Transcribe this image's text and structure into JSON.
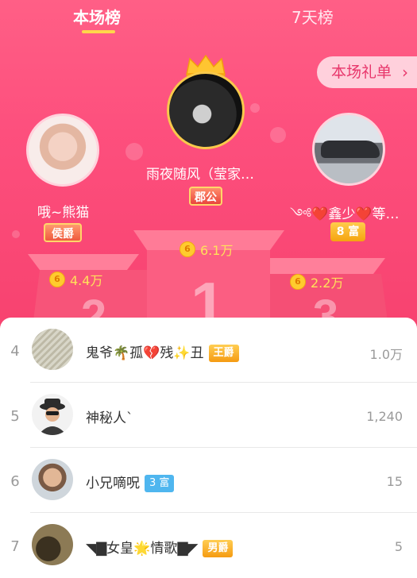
{
  "tabs": [
    {
      "label": "本场榜",
      "active": true
    },
    {
      "label": "7天榜",
      "active": false
    }
  ],
  "gift_button": {
    "label": "本场礼单",
    "icon": "chevron-right-icon"
  },
  "podium": [
    {
      "rank": 1,
      "name": "雨夜随风（莹家…",
      "badge": "郡公",
      "score": "6.1万",
      "coin": "6"
    },
    {
      "rank": 2,
      "name": "哦~熊猫",
      "badge": "侯爵",
      "score": "4.4万",
      "coin": "6"
    },
    {
      "rank": 3,
      "name": "༺❤️鑫少❤️等…",
      "badge": "8 富",
      "score": "2.2万",
      "coin": "6"
    }
  ],
  "podium_numbers": [
    "1",
    "2",
    "3"
  ],
  "list": [
    {
      "rank": "4",
      "name": "鬼爷🌴孤💔残✨丑",
      "badge": "王爵",
      "badge_style": "gold",
      "score": "1.0万"
    },
    {
      "rank": "5",
      "name": "神秘人`",
      "badge": "",
      "badge_style": "",
      "score": "1,240"
    },
    {
      "rank": "6",
      "name": "小兄嘀呪",
      "badge": "3 富",
      "badge_style": "blue",
      "score": "15"
    },
    {
      "rank": "7",
      "name": "◥▇女皇🌟情歌▇◤",
      "badge": "男爵",
      "badge_style": "gold",
      "score": "5"
    }
  ],
  "colors": {
    "accent": "#fd4f7d",
    "gold": "#ffd64a"
  }
}
